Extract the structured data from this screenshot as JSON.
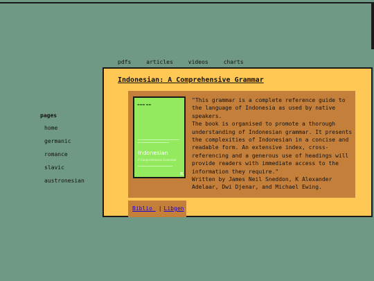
{
  "tabs": [
    "pdfs",
    "articles",
    "videos",
    "charts"
  ],
  "sidebar": {
    "heading": "pages",
    "items": [
      "home",
      "germanic",
      "romance",
      "slavic",
      "austronesian"
    ]
  },
  "book": {
    "title": "Indonesian: A Comprehensive Grammar",
    "cover_title": "Indonesian",
    "cover_subtitle": "A Comprehensive Grammar",
    "cover_logo": "R",
    "description": "\"This grammar is a complete reference guide to the language of Indonesia as used by native speakers.\nThe book is organised to promote a thorough understanding of Indonesian grammar. It presents the complexities of Indonesian in a concise and readable form. An extensive index, cross-referencing and a generous use of headings will provide readers with immediate access to the information they require.\"\nWritten by James Neil Sneddon, K Alexander Adelaar, Dwi Djenar, and Michael Ewing."
  },
  "links": {
    "biblio": "Biblio ",
    "separator": "|",
    "libgen": "Libgen"
  },
  "colors": {
    "background": "#6f9885",
    "panel": "#ffc753",
    "card": "#c47f3b",
    "cover": "#93ea5f",
    "link": "#1a00cc"
  }
}
